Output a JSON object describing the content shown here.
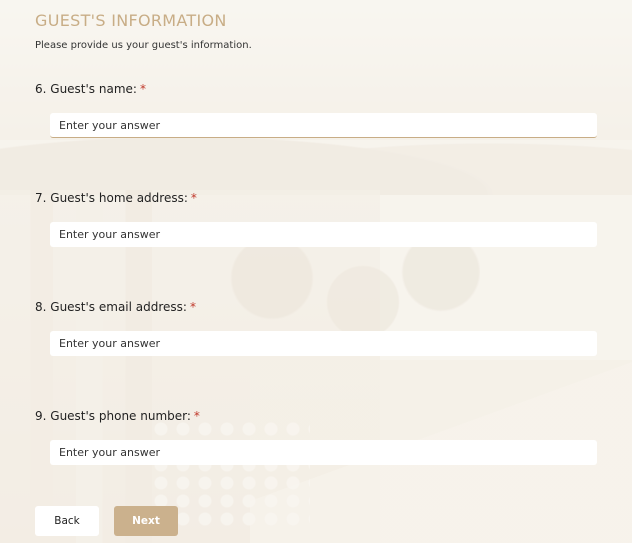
{
  "section": {
    "title": "GUEST'S INFORMATION",
    "description": "Please provide us your guest's information."
  },
  "questions": [
    {
      "number_label": "6. Guest's name:",
      "required_mark": "*",
      "placeholder": "Enter your answer"
    },
    {
      "number_label": "7. Guest's home address:",
      "required_mark": "*",
      "placeholder": "Enter your answer"
    },
    {
      "number_label": "8. Guest's email address:",
      "required_mark": "*",
      "placeholder": "Enter your answer"
    },
    {
      "number_label": "9. Guest's phone number:",
      "required_mark": "*",
      "placeholder": "Enter your answer"
    }
  ],
  "navigation": {
    "back_label": "Back",
    "next_label": "Next"
  },
  "colors": {
    "accent": "#c8ad86",
    "required": "#c0392b",
    "next_button": "#cbb18d"
  }
}
